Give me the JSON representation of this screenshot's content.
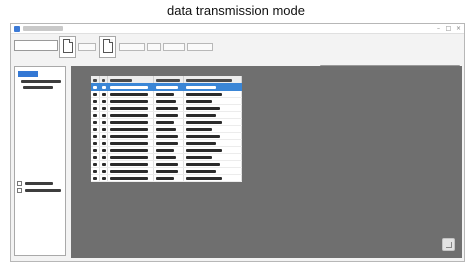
{
  "caption": "data transmission mode",
  "window": {
    "controls": {
      "minimize": "–",
      "maximize": "□",
      "close": "×"
    }
  },
  "table": {
    "selected_row": 0,
    "row_count": 14
  },
  "icons": {
    "document": "document-icon",
    "edit": "edit-note-icon"
  },
  "colors": {
    "selection": "#3a86d6",
    "content_background": "#6f6f6f"
  }
}
